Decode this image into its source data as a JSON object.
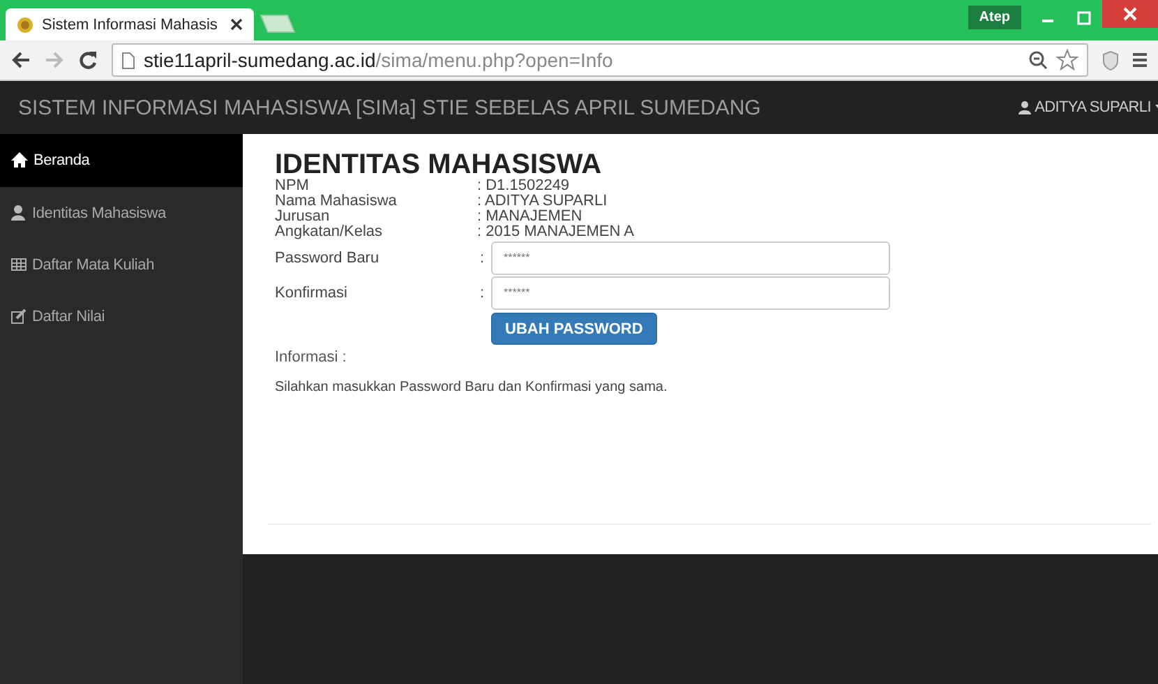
{
  "browser": {
    "tab_title": "Sistem Informasi Mahasis",
    "profile": "Atep",
    "url_host": "stie11april-sumedang.ac.id",
    "url_path": "/sima/menu.php?open=Info"
  },
  "navbar": {
    "title": "SISTEM INFORMASI MAHASISWA [SIMa] STIE SEBELAS APRIL SUMEDANG",
    "user": "ADITYA SUPARLI"
  },
  "sidebar": {
    "items": [
      {
        "label": "Beranda",
        "selected": true
      },
      {
        "label": "Identitas Mahasiswa",
        "selected": false
      },
      {
        "label": "Daftar Mata Kuliah",
        "selected": false
      },
      {
        "label": "Daftar Nilai",
        "selected": false
      }
    ]
  },
  "content": {
    "heading": "IDENTITAS MAHASISWA",
    "details": [
      {
        "label": "NPM",
        "value": ": D1.1502249"
      },
      {
        "label": "Nama Mahasiswa",
        "value": ": ADITYA SUPARLI"
      },
      {
        "label": "Jurusan",
        "value": ": MANAJEMEN"
      },
      {
        "label": "Angkatan/Kelas",
        "value": ": 2015 MANAJEMEN A"
      }
    ],
    "fields": [
      {
        "label": "Password Baru",
        "colon": ":",
        "placeholder": "******"
      },
      {
        "label": "Konfirmasi",
        "colon": ":",
        "placeholder": "******"
      }
    ],
    "button": "UBAH PASSWORD",
    "info_label": "Informasi :",
    "info_text": "Silahkan masukkan Password Baru dan Konfirmasi yang sama."
  }
}
